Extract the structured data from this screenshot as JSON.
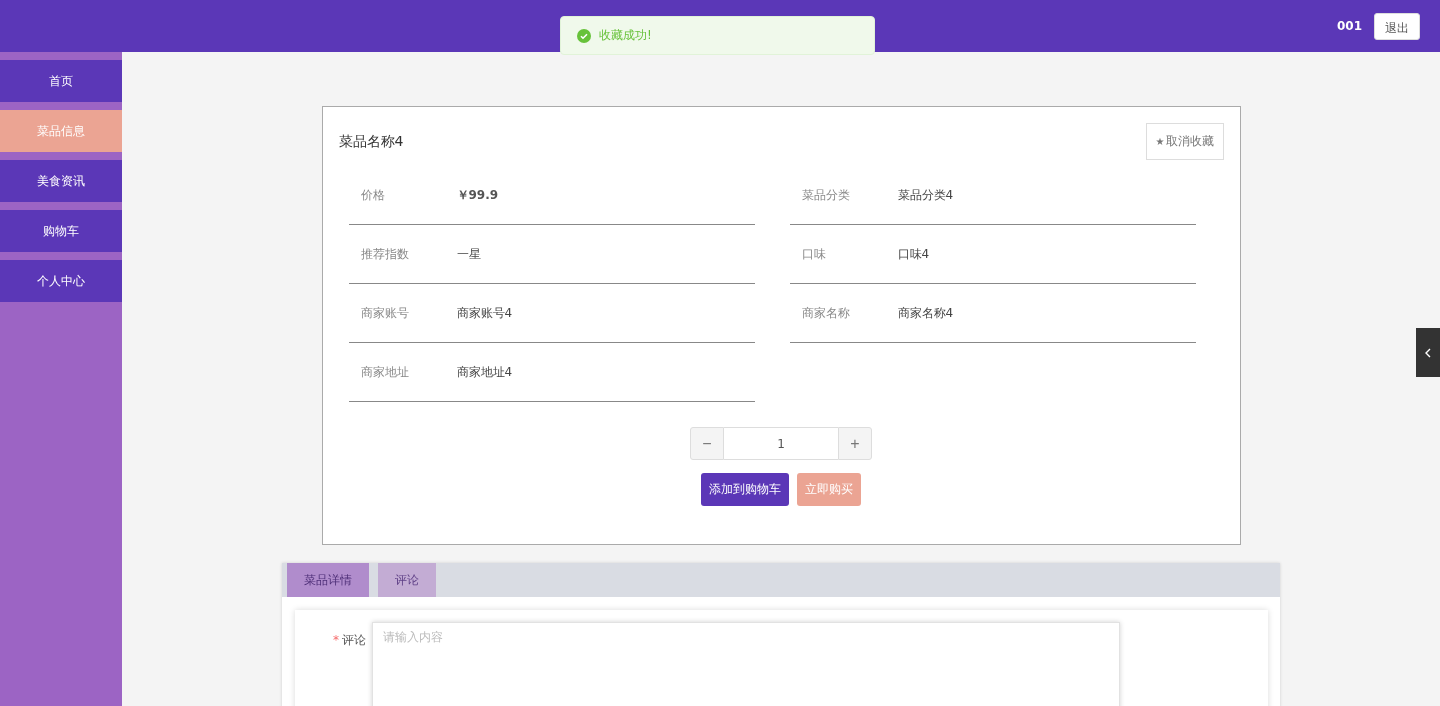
{
  "header": {
    "user": "001",
    "logout": "退出"
  },
  "toast": {
    "kind": "success",
    "message": "收藏成功!"
  },
  "sidebar": {
    "items": [
      {
        "label": "首页",
        "selected": false
      },
      {
        "label": "菜品信息",
        "selected": true
      },
      {
        "label": "美食资讯",
        "selected": false
      },
      {
        "label": "购物车",
        "selected": false
      },
      {
        "label": "个人中心",
        "selected": false
      }
    ]
  },
  "product": {
    "name": "菜品名称4",
    "favorite_icon": "★",
    "favorite_label": "取消收藏",
    "fields": [
      {
        "label": "价格",
        "value": "￥99.9",
        "kind": "price"
      },
      {
        "label": "菜品分类",
        "value": "菜品分类4",
        "kind": "text"
      },
      {
        "label": "推荐指数",
        "value": "一星",
        "kind": "text"
      },
      {
        "label": "口味",
        "value": "口味4",
        "kind": "text"
      },
      {
        "label": "商家账号",
        "value": "商家账号4",
        "kind": "text"
      },
      {
        "label": "商家名称",
        "value": "商家名称4",
        "kind": "text"
      },
      {
        "label": "商家地址",
        "value": "商家地址4",
        "kind": "text"
      }
    ],
    "quantity": {
      "minus": "−",
      "value": "1",
      "plus": "+"
    },
    "buttons": [
      {
        "label": "添加到购物车",
        "kind": "primary"
      },
      {
        "label": "立即购买",
        "kind": "secondary"
      }
    ]
  },
  "tabs": [
    {
      "label": "菜品详情",
      "selected": true
    },
    {
      "label": "评论",
      "selected": false
    }
  ],
  "comment_form": {
    "label": "评论",
    "required": true,
    "required_mark": "*",
    "placeholder": "请输入内容"
  }
}
